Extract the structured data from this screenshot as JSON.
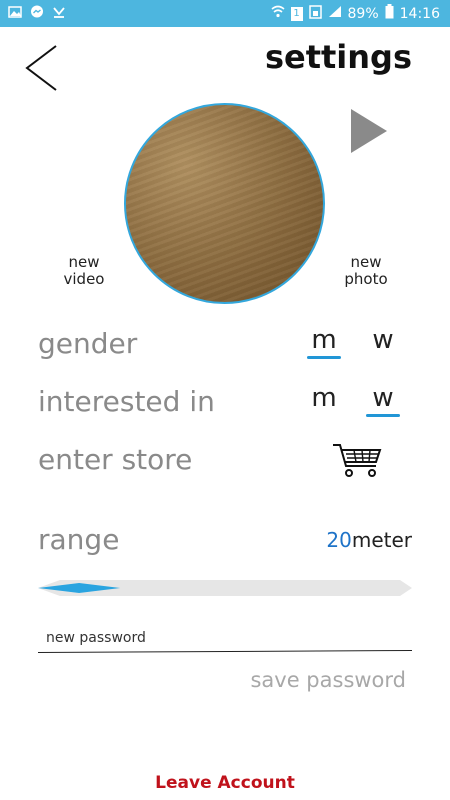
{
  "status_bar": {
    "battery": "89%",
    "time": "14:16",
    "sim": "1"
  },
  "header": {
    "title": "settings"
  },
  "media": {
    "new_video": "new\nvideo",
    "new_video_l1": "new",
    "new_video_l2": "video",
    "new_photo_l1": "new",
    "new_photo_l2": "photo"
  },
  "gender": {
    "label": "gender",
    "option_m": "m",
    "option_w": "w",
    "selected": "m"
  },
  "interested": {
    "label": "interested in",
    "option_m": "m",
    "option_w": "w",
    "selected": "w"
  },
  "store": {
    "label": "enter store"
  },
  "range": {
    "label": "range",
    "value": "20",
    "unit": "meter",
    "slider_fraction": 0.22
  },
  "password": {
    "label": "new password",
    "save_label": "save password",
    "value": ""
  },
  "footer": {
    "leave_label": "Leave Account"
  },
  "colors": {
    "accent": "#2196d6",
    "status_bar": "#4db6df",
    "danger": "#c0121b"
  }
}
